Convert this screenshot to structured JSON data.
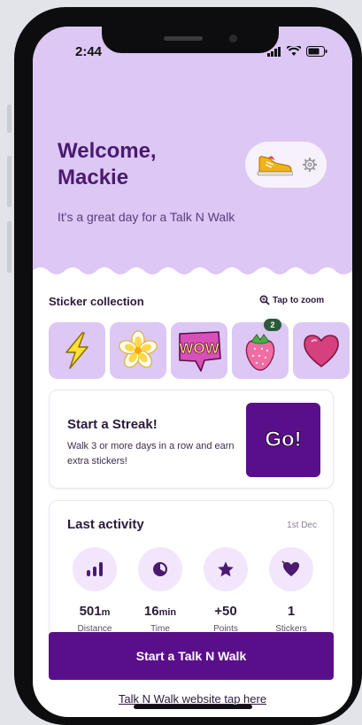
{
  "status_bar": {
    "time": "2:44"
  },
  "header": {
    "greeting": "Welcome,",
    "name": "Mackie",
    "tagline": "It's a great day for a Talk N Walk"
  },
  "icons": {
    "shoe": "sneaker-icon",
    "settings": "gear-icon",
    "zoom": "magnifier-icon"
  },
  "stickers": {
    "title": "Sticker collection",
    "zoom_label": "Tap to zoom",
    "items": [
      {
        "name": "lightning",
        "badge": ""
      },
      {
        "name": "flower",
        "badge": ""
      },
      {
        "name": "wow",
        "text": "WOW",
        "badge": ""
      },
      {
        "name": "strawberry",
        "badge": "2"
      },
      {
        "name": "heart",
        "badge": ""
      }
    ]
  },
  "streak": {
    "title": "Start a Streak!",
    "description": "Walk 3 or more days in a row and earn extra stickers!",
    "button": "Go!"
  },
  "activity": {
    "title": "Last activity",
    "date": "1st Dec",
    "stats": [
      {
        "value": "501",
        "unit": "m",
        "label": "Distance",
        "icon": "bars-icon"
      },
      {
        "value": "16",
        "unit": "min",
        "label": "Time",
        "icon": "timer-icon"
      },
      {
        "value": "+50",
        "unit": "",
        "label": "Points",
        "icon": "star-icon"
      },
      {
        "value": "1",
        "unit": "",
        "label": "Stickers",
        "icon": "heart-tag-icon"
      }
    ]
  },
  "cta": {
    "label": "Start a Talk N Walk"
  },
  "footer": {
    "link": "Talk N Walk website tap here"
  },
  "colors": {
    "hero_bg": "#dcc7f5",
    "primary": "#5a0f8a",
    "text_dark": "#2c1a3c",
    "heading": "#4a1a6e"
  }
}
